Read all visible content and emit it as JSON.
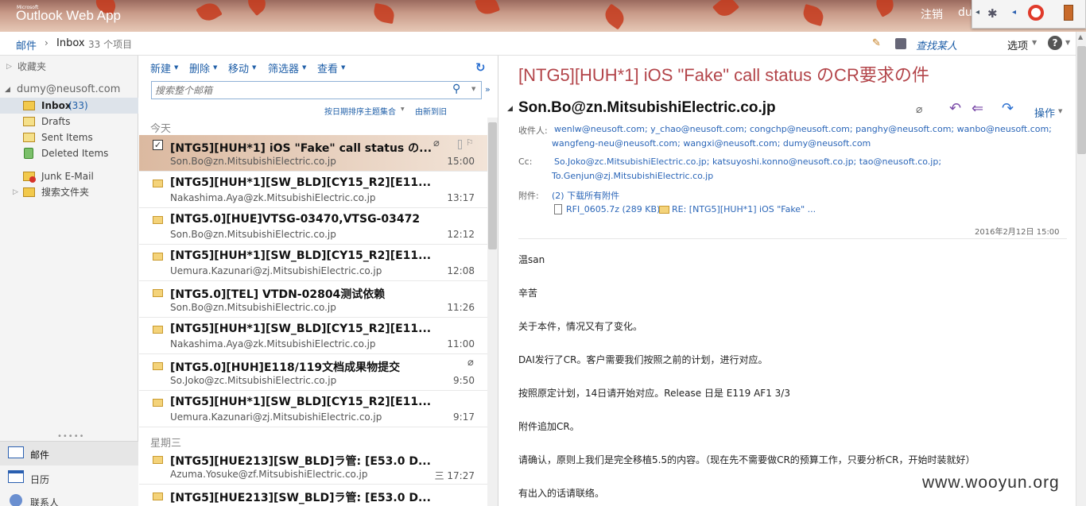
{
  "app": {
    "brand_small": "Microsoft",
    "brand": "Outlook Web App",
    "signout": "注销",
    "user_short": "du"
  },
  "subbar": {
    "breadcrumb_mail": "邮件",
    "breadcrumb_folder": "Inbox",
    "item_count": "33 个项目",
    "find_person": "查找某人",
    "options": "选项"
  },
  "nav": {
    "favorites": "收藏夹",
    "account": "dumy@neusoft.com",
    "inbox": "Inbox",
    "inbox_count": "(33)",
    "drafts": "Drafts",
    "sent": "Sent Items",
    "deleted": "Deleted Items",
    "junk": "Junk E-Mail",
    "search_folders": "搜索文件夹",
    "mail": "邮件",
    "calendar": "日历",
    "contacts": "联系人"
  },
  "toolbar": {
    "new": "新建",
    "delete": "删除",
    "move": "移动",
    "filter": "筛选器",
    "view": "查看",
    "sort": "按日期排序主题集合",
    "order": "由新到旧"
  },
  "search": {
    "placeholder": "搜索整个邮箱"
  },
  "groups": {
    "today": "今天",
    "wednesday": "星期三"
  },
  "messages": [
    {
      "subject": "[NTG5][HUH*1] iOS \"Fake\" call status の...",
      "from": "Son.Bo@zn.MitsubishiElectric.co.jp",
      "time": "15:00"
    },
    {
      "subject": "[NTG5][HUH*1][SW_BLD][CY15_R2][E11...",
      "from": "Nakashima.Aya@zk.MitsubishiElectric.co.jp",
      "time": "13:17"
    },
    {
      "subject": "[NTG5.0][HUE]VTSG-03470,VTSG-03472",
      "from": "Son.Bo@zn.MitsubishiElectric.co.jp",
      "time": "12:12"
    },
    {
      "subject": "[NTG5][HUH*1][SW_BLD][CY15_R2][E11...",
      "from": "Uemura.Kazunari@zj.MitsubishiElectric.co.jp",
      "time": "12:08"
    },
    {
      "subject": "[NTG5.0][TEL] VTDN-02804测试依赖",
      "from": "Son.Bo@zn.MitsubishiElectric.co.jp",
      "time": "11:26"
    },
    {
      "subject": "[NTG5][HUH*1][SW_BLD][CY15_R2][E11...",
      "from": "Nakashima.Aya@zk.MitsubishiElectric.co.jp",
      "time": "11:00"
    },
    {
      "subject": "[NTG5.0][HUH]E118/119文档成果物提交",
      "from": "So.Joko@zc.MitsubishiElectric.co.jp",
      "time": "9:50"
    },
    {
      "subject": "[NTG5][HUH*1][SW_BLD][CY15_R2][E11...",
      "from": "Uemura.Kazunari@zj.MitsubishiElectric.co.jp",
      "time": "9:17"
    },
    {
      "subject": "[NTG5][HUE213][SW_BLD]ラ管: [E53.0 D...",
      "from": "Azuma.Yosuke@zf.MitsubishiElectric.co.jp",
      "time": "三 17:27"
    },
    {
      "subject": "[NTG5][HUE213][SW_BLD]ラ管: [E53.0 D...",
      "from": "",
      "time": ""
    }
  ],
  "reading": {
    "subject": "[NTG5][HUH*1] iOS \"Fake\" call status のCR要求の件",
    "sender": "Son.Bo@zn.MitsubishiElectric.co.jp",
    "actions": "操作",
    "to_label": "收件人:",
    "to_line1": "wenlw@neusoft.com; y_chao@neusoft.com; congchp@neusoft.com; panghy@neusoft.com; wanbo@neusoft.com;",
    "to_line2": "wangfeng-neu@neusoft.com; wangxi@neusoft.com; dumy@neusoft.com",
    "cc_label": "Cc:",
    "cc_line1": "So.Joko@zc.MitsubishiElectric.co.jp; katsuyoshi.konno@neusoft.co.jp; tao@neusoft.co.jp;",
    "cc_line2": "To.Genjun@zj.MitsubishiElectric.co.jp",
    "att_label": "附件:",
    "att_count": "(2)  下载所有附件",
    "att1": "RFI_0605.7z (289 KB);",
    "att2": "RE: [NTG5][HUH*1] iOS \"Fake\" ...",
    "date": "2016年2月12日 15:00",
    "body": [
      "温san",
      "辛苦",
      "关于本件，情况又有了变化。",
      "DAI发行了CR。客户需要我们按照之前的计划，进行对应。",
      "按照原定计划，14日请开始对应。Release 日是 E119 AF1 3/3",
      "附件追加CR。",
      "请确认，原则上我们是完全移植5.5的内容。（现在先不需要做CR的预算工作，只要分析CR，开始时装就好）",
      "有出入的话请联络。"
    ]
  },
  "watermark": "www.wooyun.org"
}
